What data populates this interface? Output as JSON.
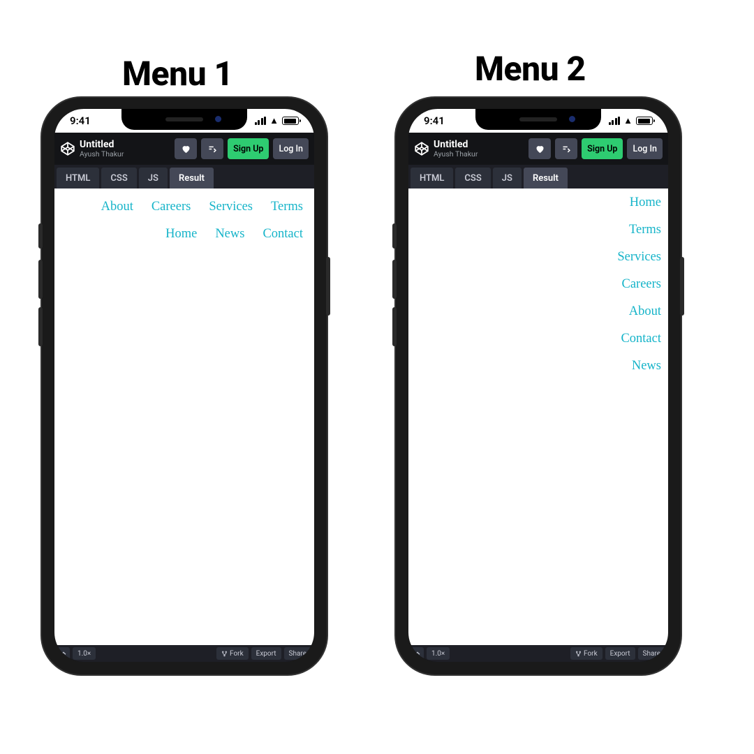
{
  "headings": {
    "menu1": "Menu 1",
    "menu2": "Menu 2"
  },
  "status": {
    "time": "9:41"
  },
  "codepen": {
    "title": "Untitled",
    "author": "Ayush Thakur",
    "buttons": {
      "signup": "Sign Up",
      "login": "Log In"
    },
    "tabs": {
      "html": "HTML",
      "css": "CSS",
      "js": "JS",
      "result": "Result"
    },
    "footer": {
      "zoom": "1.0×",
      "fork": "Fork",
      "export": "Export",
      "share": "Share"
    }
  },
  "menu1": {
    "row1": [
      "About",
      "Careers",
      "Services",
      "Terms"
    ],
    "row2": [
      "Home",
      "News",
      "Contact"
    ]
  },
  "menu2": {
    "items": [
      "Home",
      "Terms",
      "Services",
      "Careers",
      "About",
      "Contact",
      "News"
    ]
  }
}
